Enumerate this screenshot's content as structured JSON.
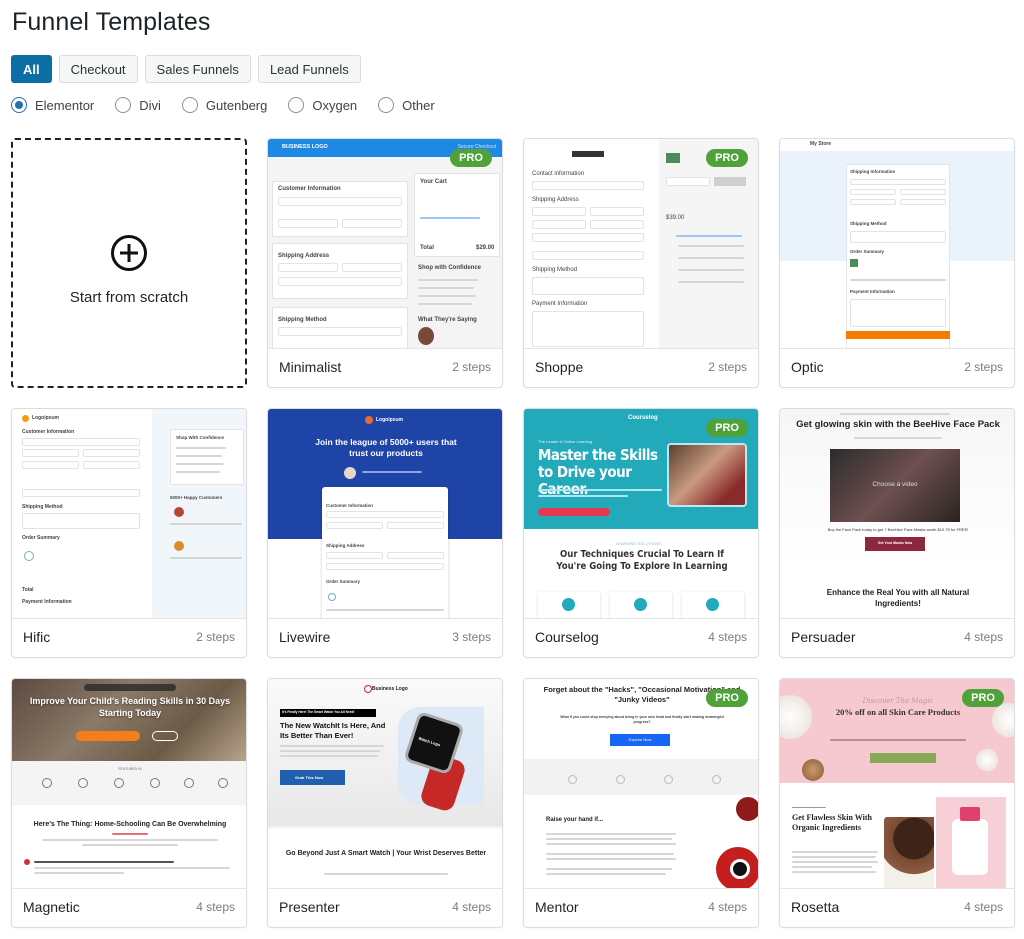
{
  "page": {
    "title": "Funnel Templates"
  },
  "tabs": [
    {
      "label": "All",
      "active": true
    },
    {
      "label": "Checkout",
      "active": false
    },
    {
      "label": "Sales Funnels",
      "active": false
    },
    {
      "label": "Lead Funnels",
      "active": false
    }
  ],
  "builders": [
    {
      "label": "Elementor",
      "checked": true
    },
    {
      "label": "Divi",
      "checked": false
    },
    {
      "label": "Gutenberg",
      "checked": false
    },
    {
      "label": "Oxygen",
      "checked": false
    },
    {
      "label": "Other",
      "checked": false
    }
  ],
  "scratch": {
    "label": "Start from scratch",
    "icon": "plus-circle-icon"
  },
  "pro_badge": "PRO",
  "colors": {
    "accent": "#0b6fa5",
    "radio_checked": "#2271b1",
    "pro_badge": "#4fa23a"
  },
  "templates": [
    {
      "name": "Minimalist",
      "steps": "2 steps",
      "pro": true,
      "preview": {
        "logo": "BUSINESS LOGO",
        "secure": "Secure Checkout",
        "customer": "Customer Information",
        "shipping_address": "Shipping Address",
        "shipping_method": "Shipping Method",
        "cart": "Your Cart",
        "total": "Total",
        "total_value": "$29.00",
        "confidence": "Shop with Confidence",
        "saying": "What They're Saying"
      }
    },
    {
      "name": "Shoppe",
      "steps": "2 steps",
      "pro": true,
      "preview": {
        "contact": "Contact information",
        "shipping_address": "Shipping Address",
        "shipping_method": "Shipping Method",
        "payment": "Payment Information",
        "total_value": "$39.00"
      }
    },
    {
      "name": "Optic",
      "steps": "2 steps",
      "pro": false,
      "preview": {
        "store": "My Store",
        "shipping_info": "Shipping Information",
        "shipping_method": "Shipping Method",
        "order_summary": "Order Summary",
        "payment": "Payment Information"
      }
    },
    {
      "name": "Hific",
      "steps": "2 steps",
      "pro": false,
      "preview": {
        "logo": "Logoipsum",
        "customer": "Customer Information",
        "shipping_method": "Shipping Method",
        "order_summary": "Order Summary",
        "total": "Total",
        "payment": "Payment Information",
        "confidence": "Shop With Confidence",
        "happy": "5000+ Happy Customers"
      }
    },
    {
      "name": "Livewire",
      "steps": "3 steps",
      "pro": false,
      "preview": {
        "logo": "Logoipsum",
        "headline": "Join the league of 5000+ users that trust our products",
        "customer": "Customer Information",
        "shipping_address": "Shipping Address",
        "order_summary": "Order Summary"
      }
    },
    {
      "name": "Courselog",
      "steps": "4 steps",
      "pro": true,
      "preview": {
        "logo": "Courselog",
        "kicker": "The Leader in Online Learning",
        "headline": "Master the Skills to Drive your Career.",
        "section_kicker": "LEARNING SOLUTIONS",
        "section_title": "Our Techniques Crucial To Learn If You're Going To Explore In Learning"
      }
    },
    {
      "name": "Persuader",
      "steps": "4 steps",
      "pro": false,
      "preview": {
        "headline": "Get glowing skin with the BeeHive Face Pack",
        "video": "Choose a video",
        "offer": "Buy the Face Pack today to get 7 BeeHive Face Masks worth $19.75 for FREE!",
        "cta": "Get Your Masks Now",
        "section_title": "Enhance the Real You with all Natural Ingredients!"
      }
    },
    {
      "name": "Magnetic",
      "steps": "4 steps",
      "pro": false,
      "preview": {
        "headline": "Improve Your Child's Reading Skills in 30 Days Starting Today",
        "featured": "FEATURED IN",
        "section_title": "Here's The Thing: Home-Schooling Can Be Overwhelming"
      }
    },
    {
      "name": "Presenter",
      "steps": "4 steps",
      "pro": false,
      "preview": {
        "logo": "Business Logo",
        "strip": "It's Finally Here! The Smart Watch You All Need!",
        "headline": "The New WatchIt Is Here, And Its Better Than Ever!",
        "cta": "Grab This Now",
        "watch_logo": "Watch Logo",
        "section_title": "Go Beyond Just A Smart Watch | Your Wrist Deserves Better"
      }
    },
    {
      "name": "Mentor",
      "steps": "4 steps",
      "pro": true,
      "preview": {
        "headline": "Forget about the \"Hacks\", \"Occasional Motivation\" and \"Junky Videos\"",
        "sub": "What if you could stop worrying about being in your own head and finally start making meaningful progress?",
        "cta": "Explore Now",
        "section_title": "Raise your hand if..."
      }
    },
    {
      "name": "Rosetta",
      "steps": "4 steps",
      "pro": true,
      "preview": {
        "script": "Discover The Magic",
        "headline": "20% off on all Skin Care Products",
        "section_title": "Get Flawless Skin With Organic Ingredients"
      }
    }
  ]
}
